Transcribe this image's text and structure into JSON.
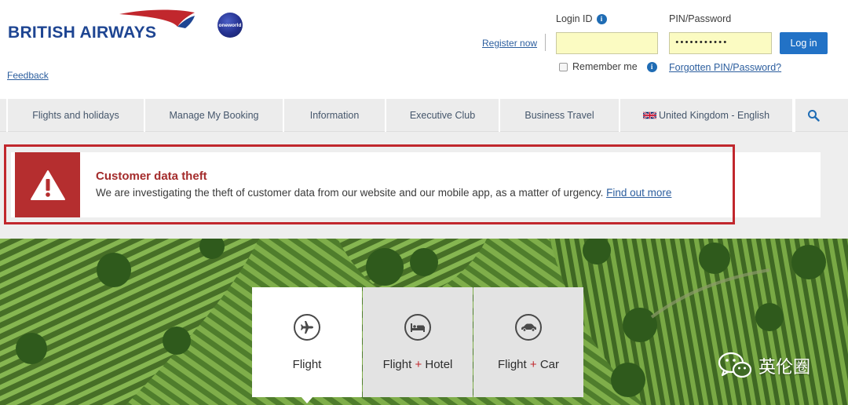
{
  "header": {
    "brand": "BRITISH AIRWAYS",
    "oneworld_badge": "oneworld",
    "feedback_link": "Feedback",
    "register_link": "Register now",
    "login_id_label": "Login ID",
    "login_id_value": "",
    "pin_label": "PIN/Password",
    "pin_value": "•••••••••••",
    "login_button": "Log in",
    "remember_label": "Remember me",
    "forgot_link": "Forgotten PIN/Password?"
  },
  "nav": {
    "items": [
      {
        "label": "Flights and holidays"
      },
      {
        "label": "Manage My Booking"
      },
      {
        "label": "Information"
      },
      {
        "label": "Executive Club"
      },
      {
        "label": "Business Travel"
      },
      {
        "label": "United Kingdom - English"
      }
    ],
    "search_icon": "search-icon"
  },
  "alert": {
    "title": "Customer data theft",
    "message": "We are investigating the theft of customer data from our website and our mobile app, as a matter of urgency.",
    "link": "Find out more",
    "icon": "warning-icon"
  },
  "booking_tabs": [
    {
      "label_main": "Flight",
      "label_plus": "",
      "label_extra": "",
      "icon": "plane-icon",
      "active": true
    },
    {
      "label_main": "Flight",
      "label_plus": "+",
      "label_extra": "Hotel",
      "icon": "bed-icon",
      "active": false
    },
    {
      "label_main": "Flight",
      "label_plus": "+",
      "label_extra": "Car",
      "icon": "car-icon",
      "active": false
    }
  ],
  "watermark": {
    "text": "英伦圈"
  },
  "colors": {
    "brand_blue": "#1e4592",
    "alert_red": "#b52e2f",
    "login_blue": "#2272c6",
    "input_yellow": "#fbfbc2"
  }
}
